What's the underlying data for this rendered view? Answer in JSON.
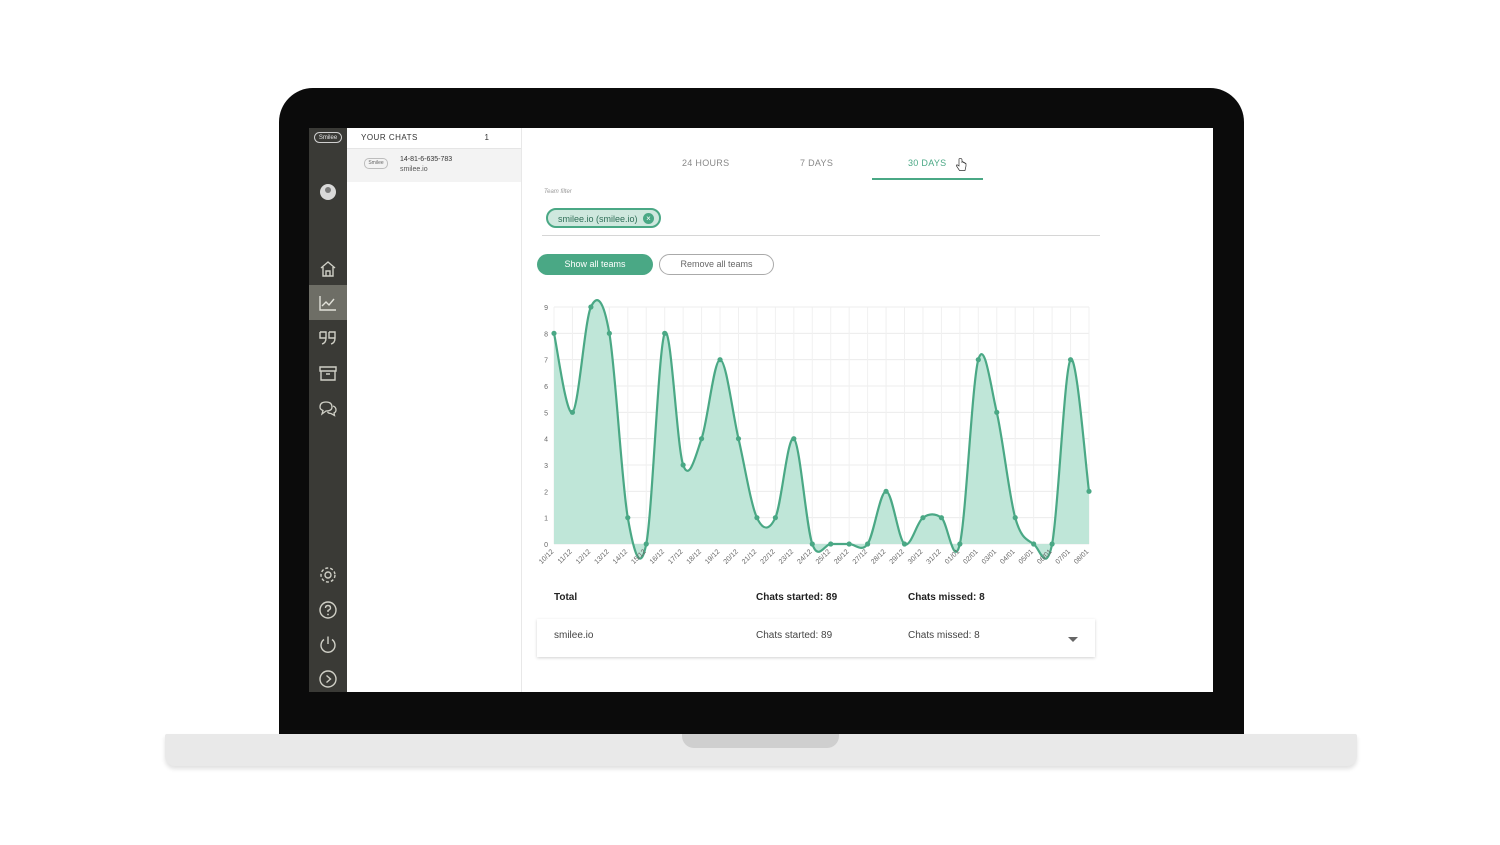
{
  "rail": {
    "logo": "Smilee"
  },
  "chats": {
    "title": "YOUR CHATS",
    "count": "1",
    "item": {
      "logo": "Smilee",
      "id": "14-81-6-635-783",
      "sub": "smilee.io"
    }
  },
  "tabs": [
    {
      "label": "24 HOURS"
    },
    {
      "label": "7 DAYS"
    },
    {
      "label": "30 DAYS"
    }
  ],
  "filter": {
    "label": "Team filter",
    "chip": "smilee.io (smilee.io)"
  },
  "buttons": {
    "show_all": "Show all teams",
    "remove_all": "Remove all teams"
  },
  "summary": {
    "label": "Total",
    "started": "Chats started: 89",
    "missed": "Chats missed: 8"
  },
  "row": {
    "name": "smilee.io",
    "started": "Chats started: 89",
    "missed": "Chats missed: 8"
  },
  "colors": {
    "accent": "#4aa885",
    "area_fill": "#bfe6d8"
  },
  "chart_data": {
    "type": "area",
    "x": [
      "10/12",
      "11/12",
      "12/12",
      "13/12",
      "14/12",
      "15/12",
      "16/12",
      "17/12",
      "18/12",
      "19/12",
      "20/12",
      "21/12",
      "22/12",
      "23/12",
      "24/12",
      "25/12",
      "26/12",
      "27/12",
      "28/12",
      "29/12",
      "30/12",
      "31/12",
      "01/01",
      "02/01",
      "03/01",
      "04/01",
      "05/01",
      "06/01",
      "07/01",
      "08/01"
    ],
    "series": [
      {
        "values": [
          8,
          5,
          9,
          8,
          1,
          0,
          8,
          3,
          4,
          7,
          4,
          1,
          1,
          4,
          0,
          0,
          0,
          0,
          2,
          0,
          1,
          1,
          0,
          7,
          5,
          1,
          0,
          0,
          7,
          2
        ]
      }
    ],
    "yticks": [
      0,
      1,
      2,
      3,
      4,
      5,
      6,
      7,
      8,
      9
    ],
    "ylim": [
      0,
      9
    ],
    "grid": true
  }
}
